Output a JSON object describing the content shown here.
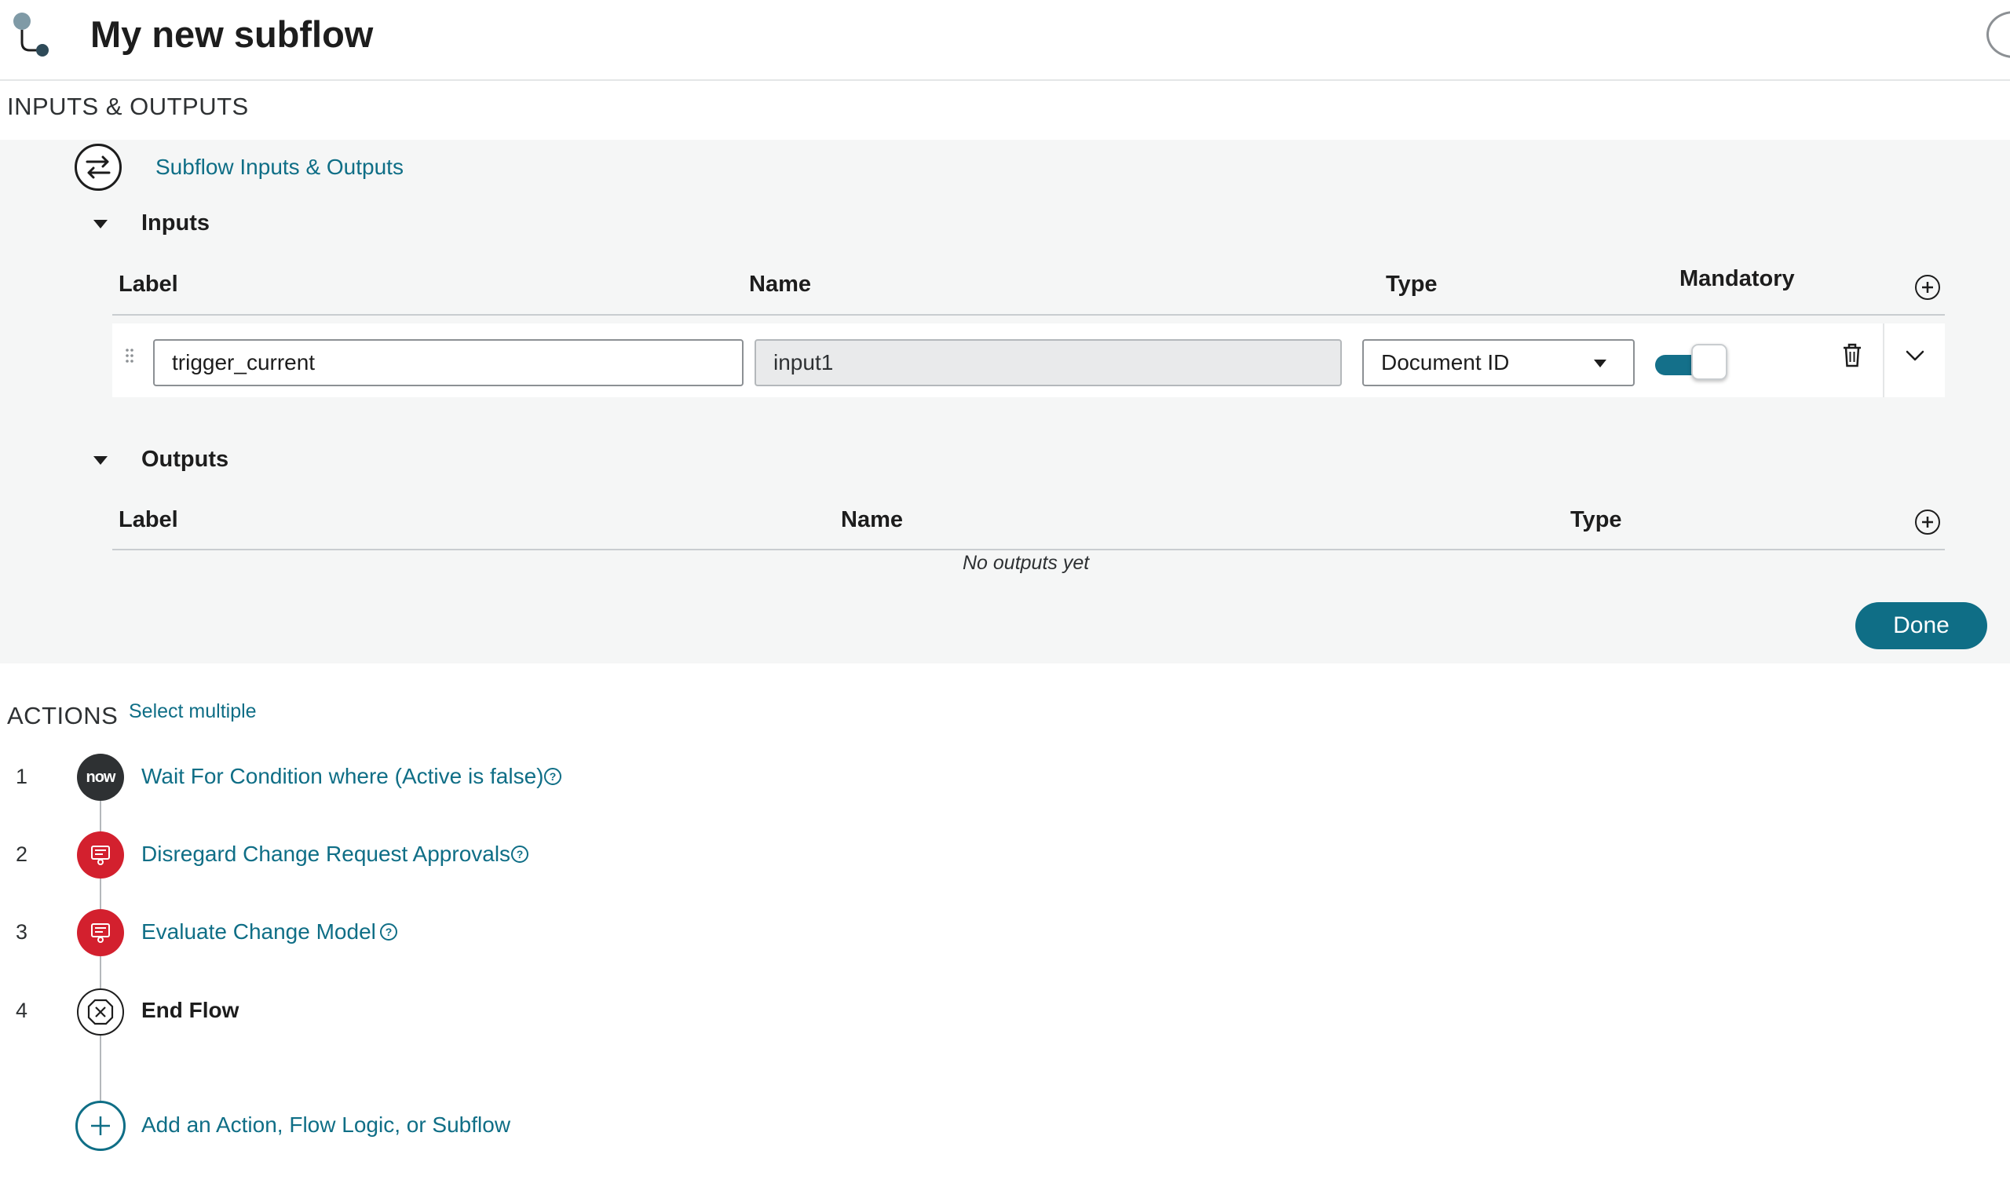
{
  "header": {
    "title": "My new subflow"
  },
  "io": {
    "section_label": "INPUTS & OUTPUTS",
    "link": "Subflow Inputs & Outputs",
    "inputs": {
      "title": "Inputs",
      "columns": {
        "label": "Label",
        "name": "Name",
        "type": "Type",
        "mandatory": "Mandatory"
      },
      "row": {
        "label_value": "trigger_current",
        "name_value": "input1",
        "type_value": "Document ID",
        "mandatory": true
      }
    },
    "outputs": {
      "title": "Outputs",
      "columns": {
        "label": "Label",
        "name": "Name",
        "type": "Type"
      },
      "empty": "No outputs yet"
    },
    "done_label": "Done"
  },
  "actions": {
    "section_label": "ACTIONS",
    "select_multiple": "Select multiple",
    "steps": [
      {
        "num": "1",
        "label": "Wait For Condition where (Active is false)"
      },
      {
        "num": "2",
        "label": "Disregard Change Request Approvals"
      },
      {
        "num": "3",
        "label": "Evaluate Change Model"
      },
      {
        "num": "4",
        "label": "End Flow"
      }
    ],
    "now_logo": "now",
    "add_label": "Add an Action, Flow Logic, or Subflow"
  },
  "colors": {
    "accent": "#0f6e86",
    "toggle": "#14708a",
    "spoke_red": "#d3202e",
    "panel": "#f5f6f6"
  }
}
